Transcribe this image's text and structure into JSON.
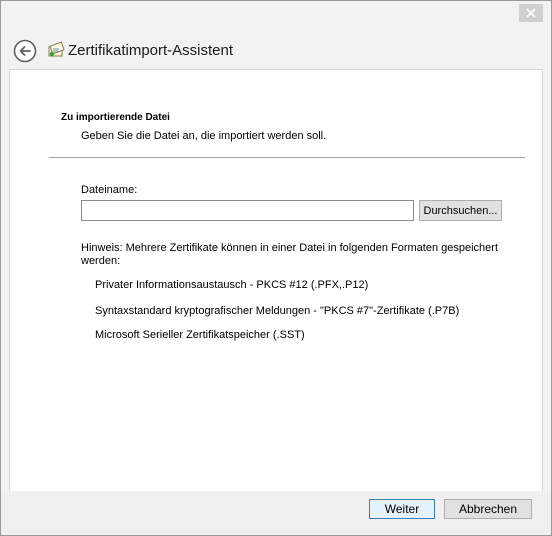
{
  "window": {
    "close_icon": "close-icon"
  },
  "header": {
    "back_icon": "back-arrow-icon",
    "app_icon": "certificate-icon",
    "title": "Zertifikatimport-Assistent"
  },
  "section": {
    "title": "Zu importierende Datei",
    "description": "Geben Sie die Datei an, die importiert werden soll."
  },
  "form": {
    "filename_label": "Dateiname:",
    "filename_value": "",
    "browse_label": "Durchsuchen..."
  },
  "hint": "Hinweis: Mehrere Zertifikate können in einer Datei in folgenden Formaten gespeichert werden:",
  "formats": [
    "Privater Informationsaustausch - PKCS #12 (.PFX,.P12)",
    "Syntaxstandard kryptografischer Meldungen - \"PKCS #7\"-Zertifikate (.P7B)",
    "Microsoft Serieller Zertifikatspeicher (.SST)"
  ],
  "footer": {
    "next_label": "Weiter",
    "cancel_label": "Abbrechen"
  }
}
